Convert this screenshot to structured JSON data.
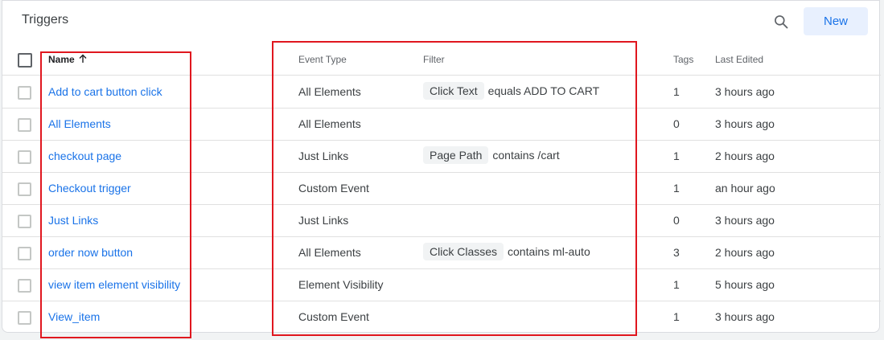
{
  "header": {
    "title": "Triggers",
    "new_label": "New"
  },
  "columns": {
    "name": "Name",
    "event_type": "Event Type",
    "filter": "Filter",
    "tags": "Tags",
    "last_edited": "Last Edited"
  },
  "rows": [
    {
      "name": "Add to cart button click",
      "event_type": "All Elements",
      "filter_var": "Click Text",
      "filter_cond": "equals ADD TO CART",
      "tags": "1",
      "last_edited": "3 hours ago"
    },
    {
      "name": "All Elements",
      "event_type": "All Elements",
      "filter_var": "",
      "filter_cond": "",
      "tags": "0",
      "last_edited": "3 hours ago"
    },
    {
      "name": "checkout page",
      "event_type": "Just Links",
      "filter_var": "Page Path",
      "filter_cond": "contains /cart",
      "tags": "1",
      "last_edited": "2 hours ago"
    },
    {
      "name": "Checkout trigger",
      "event_type": "Custom Event",
      "filter_var": "",
      "filter_cond": "",
      "tags": "1",
      "last_edited": "an hour ago"
    },
    {
      "name": "Just Links",
      "event_type": "Just Links",
      "filter_var": "",
      "filter_cond": "",
      "tags": "0",
      "last_edited": "3 hours ago"
    },
    {
      "name": "order now button",
      "event_type": "All Elements",
      "filter_var": "Click Classes",
      "filter_cond": "contains ml-auto",
      "tags": "3",
      "last_edited": "2 hours ago"
    },
    {
      "name": "view item element visibility",
      "event_type": "Element Visibility",
      "filter_var": "",
      "filter_cond": "",
      "tags": "1",
      "last_edited": "5 hours ago"
    },
    {
      "name": "View_item",
      "event_type": "Custom Event",
      "filter_var": "",
      "filter_cond": "",
      "tags": "1",
      "last_edited": "3 hours ago"
    }
  ],
  "icons": {
    "search": "search-icon",
    "sort": "arrow-up-icon"
  },
  "colors": {
    "link": "#1a73e8",
    "new_button_bg": "#e8f0fe",
    "highlight": "#e0171f"
  }
}
